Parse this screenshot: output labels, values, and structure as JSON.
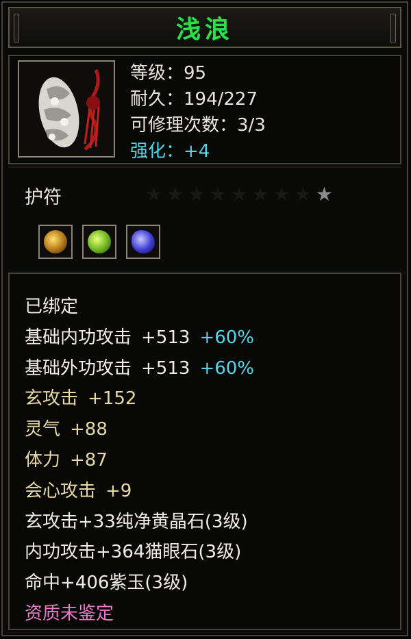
{
  "item": {
    "name": "浅浪",
    "level": "等级：95",
    "durability": "耐久：194/227",
    "repair": "可修理次数：3/3",
    "enhance": "强化：+4",
    "type": "护符",
    "stars_total": 9,
    "stars_lit": 1,
    "gem_slots": [
      "yellow-gem-icon",
      "green-gem-icon",
      "purple-gem-icon"
    ]
  },
  "attributes": [
    {
      "label": "已绑定",
      "value": "",
      "percent": "",
      "color": "#f0eee6"
    },
    {
      "label": "基础内功攻击",
      "value": "+513",
      "percent": "+60%",
      "color": "#f0eee6"
    },
    {
      "label": "基础外功攻击",
      "value": "+513",
      "percent": "+60%",
      "color": "#f0eee6"
    },
    {
      "label": "玄攻击",
      "value": "+152",
      "percent": "",
      "color": "#e8d9a6"
    },
    {
      "label": "灵气",
      "value": "+88",
      "percent": "",
      "color": "#e8d9a6"
    },
    {
      "label": "体力",
      "value": "+87",
      "percent": "",
      "color": "#e8d9a6"
    },
    {
      "label": "会心攻击",
      "value": "+9",
      "percent": "",
      "color": "#e8d9a6"
    },
    {
      "label": "玄攻击+33纯净黄晶石(3级)",
      "value": "",
      "percent": "",
      "color": "#f0eee6"
    },
    {
      "label": "内功攻击+364猫眼石(3级)",
      "value": "",
      "percent": "",
      "color": "#f0eee6"
    },
    {
      "label": "命中+406紫玉(3级)",
      "value": "",
      "percent": "",
      "color": "#f0eee6"
    },
    {
      "label": "资质未鉴定",
      "value": "",
      "percent": "",
      "color": "#e87ac6"
    }
  ]
}
